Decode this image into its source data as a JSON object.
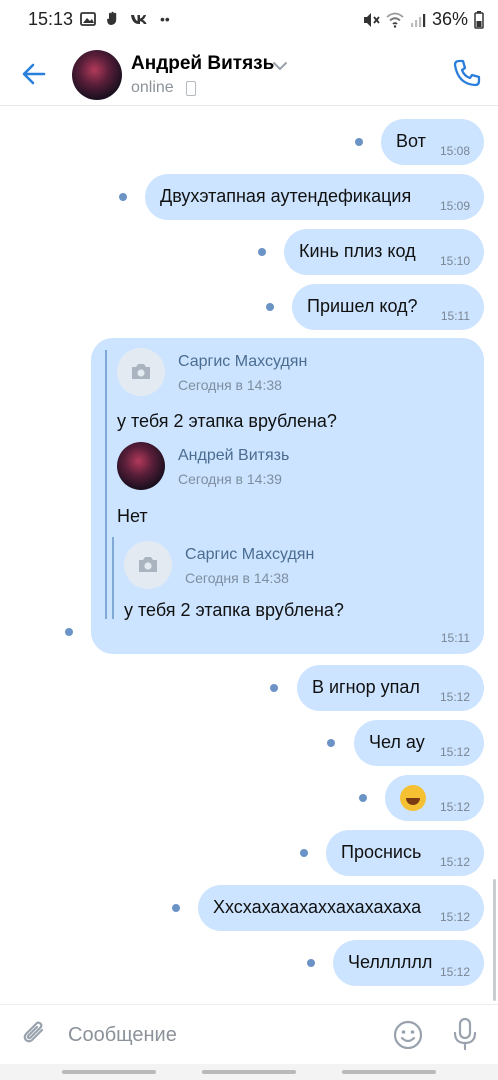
{
  "status_bar": {
    "time": "15:13",
    "left_icons": [
      "image-icon",
      "hand-icon",
      "vk-icon",
      "more-dots-icon"
    ],
    "battery": "36%"
  },
  "header": {
    "contact_name": "Андрей Витязь",
    "status": "online"
  },
  "messages": [
    {
      "text": "Вот",
      "time": "15:08"
    },
    {
      "text": "Двухэтапная аутендефикация",
      "time": "15:09"
    },
    {
      "text": "Кинь плиз код",
      "time": "15:10"
    },
    {
      "text": "Пришел код?",
      "time": "15:11"
    },
    {
      "text": "В игнор упал",
      "time": "15:12"
    },
    {
      "text": "Чел ау",
      "time": "15:12"
    },
    {
      "text": "",
      "time": "15:12",
      "emoji": "rolling-on-floor-laughing"
    },
    {
      "text": "Проснись",
      "time": "15:12"
    },
    {
      "text": "Ххсхахахахаххахахахаха",
      "time": "15:12"
    },
    {
      "text": "Челллллл",
      "time": "15:12"
    }
  ],
  "forwarded_message": {
    "time": "15:11",
    "first": {
      "author": "Саргис Махсудян",
      "date": "Сегодня в 14:38",
      "text": "у тебя 2 этапка врублена?"
    },
    "second": {
      "author": "Андрей Витязь",
      "date": "Сегодня в 14:39",
      "text": "Нет"
    },
    "nested": {
      "author": "Саргис Махсудян",
      "date": "Сегодня в 14:38",
      "text": "у тебя 2 этапка врублена?"
    }
  },
  "composer": {
    "placeholder": "Сообщение"
  },
  "colors": {
    "accent": "#2a7fdc",
    "bubble": "#cce4ff",
    "unread_dot": "#6b93c6"
  }
}
